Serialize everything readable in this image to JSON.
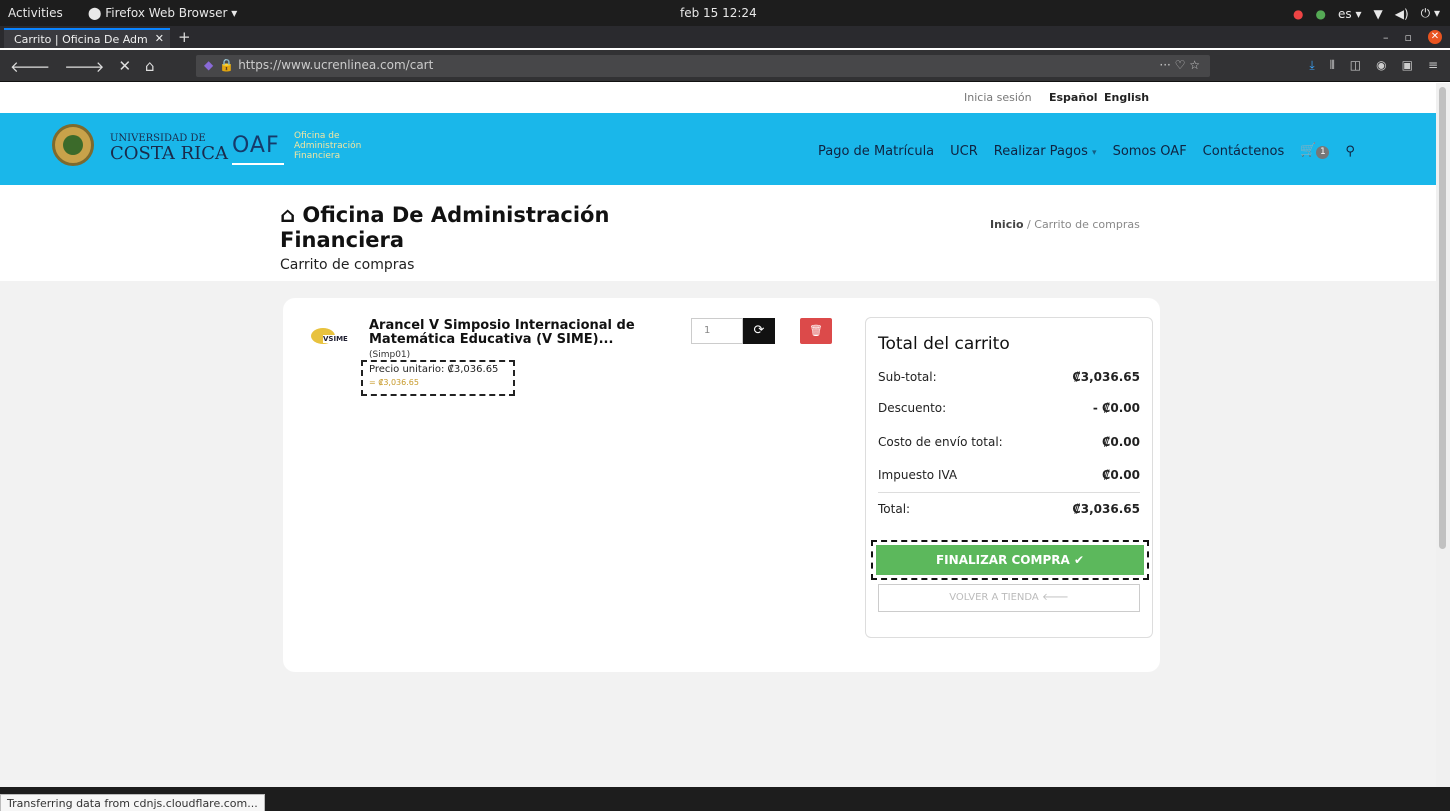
{
  "system": {
    "activities": "Activities",
    "app": "Firefox Web Browser ▾",
    "clock": "feb 15  12:24",
    "lang": "es ▾"
  },
  "browser": {
    "tab_title": "Carrito | Oficina De Adm",
    "url": "https://www.ucrenlinea.com/cart",
    "status": "Transferring data from cdnjs.cloudflare.com..."
  },
  "site": {
    "util": {
      "login": "Inicia sesión",
      "lang_es": "Español",
      "lang_en": "English"
    },
    "ucr_line1": "UNIVERSIDAD DE",
    "ucr_line2": "COSTA RICA",
    "oaf": "OAF",
    "oaf_full": [
      "Oficina de",
      "Administración",
      "Financiera"
    ],
    "nav": [
      "Pago de Matrícula",
      "UCR",
      "Realizar Pagos",
      "Somos OAF",
      "Contáctenos"
    ],
    "cart_count": "1"
  },
  "title": {
    "main": "Oficina De Administración Financiera",
    "sub": "Carrito de compras"
  },
  "breadcrumb": {
    "home": "Inicio",
    "sep": "/",
    "current": "Carrito de compras"
  },
  "item": {
    "logo_text": "VSIME",
    "name": "Arancel V Simposio Internacional de Matemática Educativa (V SIME)...",
    "sku": "(Simp01)",
    "unit_price": "Precio unitario: ₡3,036.65",
    "line_total": "= ₡3,036.65",
    "qty": "1"
  },
  "summary": {
    "title": "Total del carrito",
    "rows": [
      {
        "label": "Sub-total:",
        "value": "₡3,036.65"
      },
      {
        "label": "Descuento:",
        "value": "- ₡0.00"
      },
      {
        "label": "Costo de envío total:",
        "value": "₡0.00"
      },
      {
        "label": "Impuesto IVA",
        "value": "₡0.00"
      },
      {
        "label": "Total:",
        "value": "₡3,036.65"
      }
    ],
    "checkout": "FINALIZAR COMPRA ✔",
    "back": "VOLVER A TIENDA 🡐"
  },
  "colors": {
    "header": "#1ab7ea",
    "checkout": "#5cb85c",
    "delete": "#dc4a4a"
  }
}
